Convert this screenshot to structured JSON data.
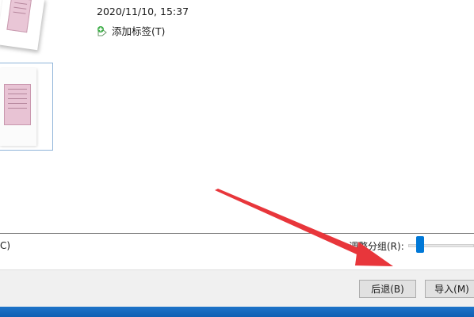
{
  "photo_info": {
    "date": "2020/11/10, 15:37",
    "add_tag_label": "添加标签(T)"
  },
  "group_bar": {
    "left_partial_text": "C)",
    "adjust_group_label": "调整分组(R):",
    "slider_level": 0.14
  },
  "buttons": {
    "back_label": "后退(B)",
    "import_label": "导入(M)"
  },
  "colors": {
    "accent": "#0078d7",
    "arrow": "#e8363b",
    "button_bar": "#f0f0f0",
    "taskbar": "#1668be"
  },
  "icons": {
    "add_tag": "tag-add-icon"
  }
}
